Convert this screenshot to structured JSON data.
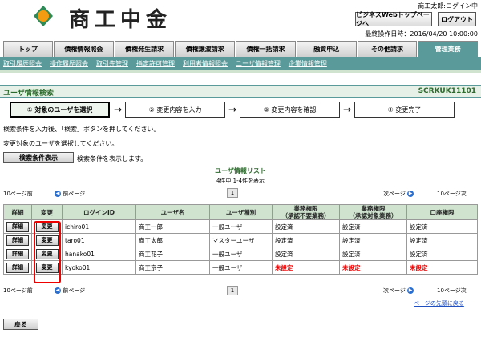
{
  "header": {
    "logo_text": "商工中金",
    "user_login": "商工太郎:ログイン中",
    "webtop_button": "ビジネスWebトップページへ",
    "logout_button": "ログアウト",
    "last_operation": "最終操作日時：2016/04/20 10:00:00"
  },
  "tabs": [
    "トップ",
    "債権情報照会",
    "債権発生請求",
    "債権譲渡請求",
    "債権一括請求",
    "融資申込",
    "その他請求",
    "管理業務"
  ],
  "subnav": [
    "取引履歴照会",
    "操作履歴照会",
    "取引先管理",
    "指定許可管理",
    "利用者情報照会",
    "ユーザ情報管理",
    "企業情報管理"
  ],
  "title": {
    "text": "ユーザ情報検索",
    "code": "SCRKUK11101"
  },
  "steps": [
    "① 対象のユーザを選択",
    "② 変更内容を入力",
    "③ 変更内容を確認",
    "④ 変更完了"
  ],
  "instructions": {
    "line1": "検索条件を入力後、「検索」ボタンを押してください。",
    "line2": "変更対象のユーザを選択してください。"
  },
  "search_toggle": {
    "button": "検索条件表示",
    "note": "検索条件を表示します。"
  },
  "list": {
    "title": "ユーザ情報リスト",
    "count": "4件中 1-4件を表示",
    "prev10": "10ページ前",
    "prev": "前ページ",
    "page": "1",
    "next": "次ページ",
    "next10": "10ページ次",
    "back_to_top": "ページの先頭に戻る"
  },
  "table": {
    "headers": [
      "詳細",
      "変更",
      "ログインID",
      "ユーザ名",
      "ユーザ種別",
      "業務権限\n（承認不要業務）",
      "業務権限\n（承認対象業務）",
      "口座権限"
    ],
    "detail_label": "詳細",
    "change_label": "変更",
    "rows": [
      {
        "login": "ichiro01",
        "name": "商工一郎",
        "type": "一般ユーザ",
        "auth1": "設定済",
        "auth2": "設定済",
        "acct": "設定済",
        "red": false
      },
      {
        "login": "taro01",
        "name": "商工太郎",
        "type": "マスターユーザ",
        "auth1": "設定済",
        "auth2": "設定済",
        "acct": "設定済",
        "red": false
      },
      {
        "login": "hanako01",
        "name": "商工花子",
        "type": "一般ユーザ",
        "auth1": "設定済",
        "auth2": "設定済",
        "acct": "設定済",
        "red": false
      },
      {
        "login": "kyoko01",
        "name": "商工京子",
        "type": "一般ユーザ",
        "auth1": "未設定",
        "auth2": "未設定",
        "acct": "未設定",
        "red": true
      }
    ]
  },
  "back_button": "戻る",
  "colors": {
    "accent": "#5a9a9a",
    "header_bg": "#cfe3cf",
    "warning": "#e00000"
  }
}
